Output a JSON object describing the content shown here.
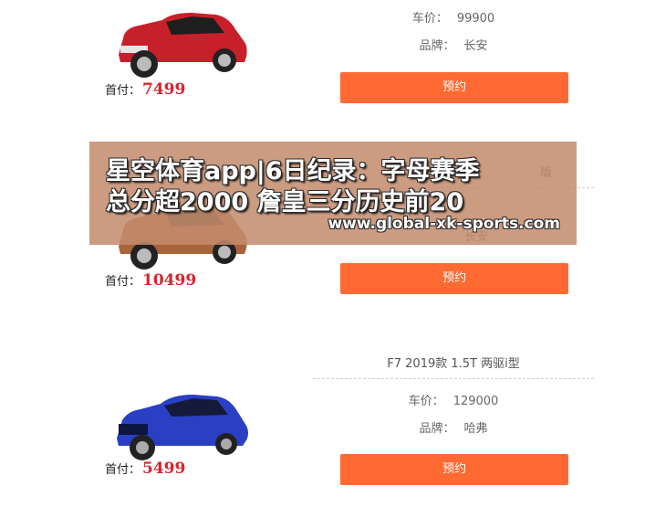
{
  "listings": [
    {
      "down_label": "首付：",
      "down_value": "7499",
      "price_label": "车价：",
      "price_value": "99900",
      "brand_label": "品牌：",
      "brand_value": "长安",
      "button": "预约",
      "car_color": "#c8202a"
    },
    {
      "title_partial": "版",
      "down_label": "首付：",
      "down_value": "10499",
      "brand_value_partial": "长安",
      "button": "预约",
      "car_color": "#a9643c"
    },
    {
      "title": "F7 2019款 1.5T 两驱i型",
      "down_label": "首付：",
      "down_value": "5499",
      "price_label": "车价：",
      "price_value": "129000",
      "brand_label": "品牌：",
      "brand_value": "哈弗",
      "button": "预约",
      "car_color": "#2a3fc4"
    }
  ],
  "banner": {
    "line1": "星空体育app|6日纪录：字母赛季",
    "line2": "总分超2000 詹皇三分历史前20",
    "url": "www.global-xk-sports.com"
  }
}
